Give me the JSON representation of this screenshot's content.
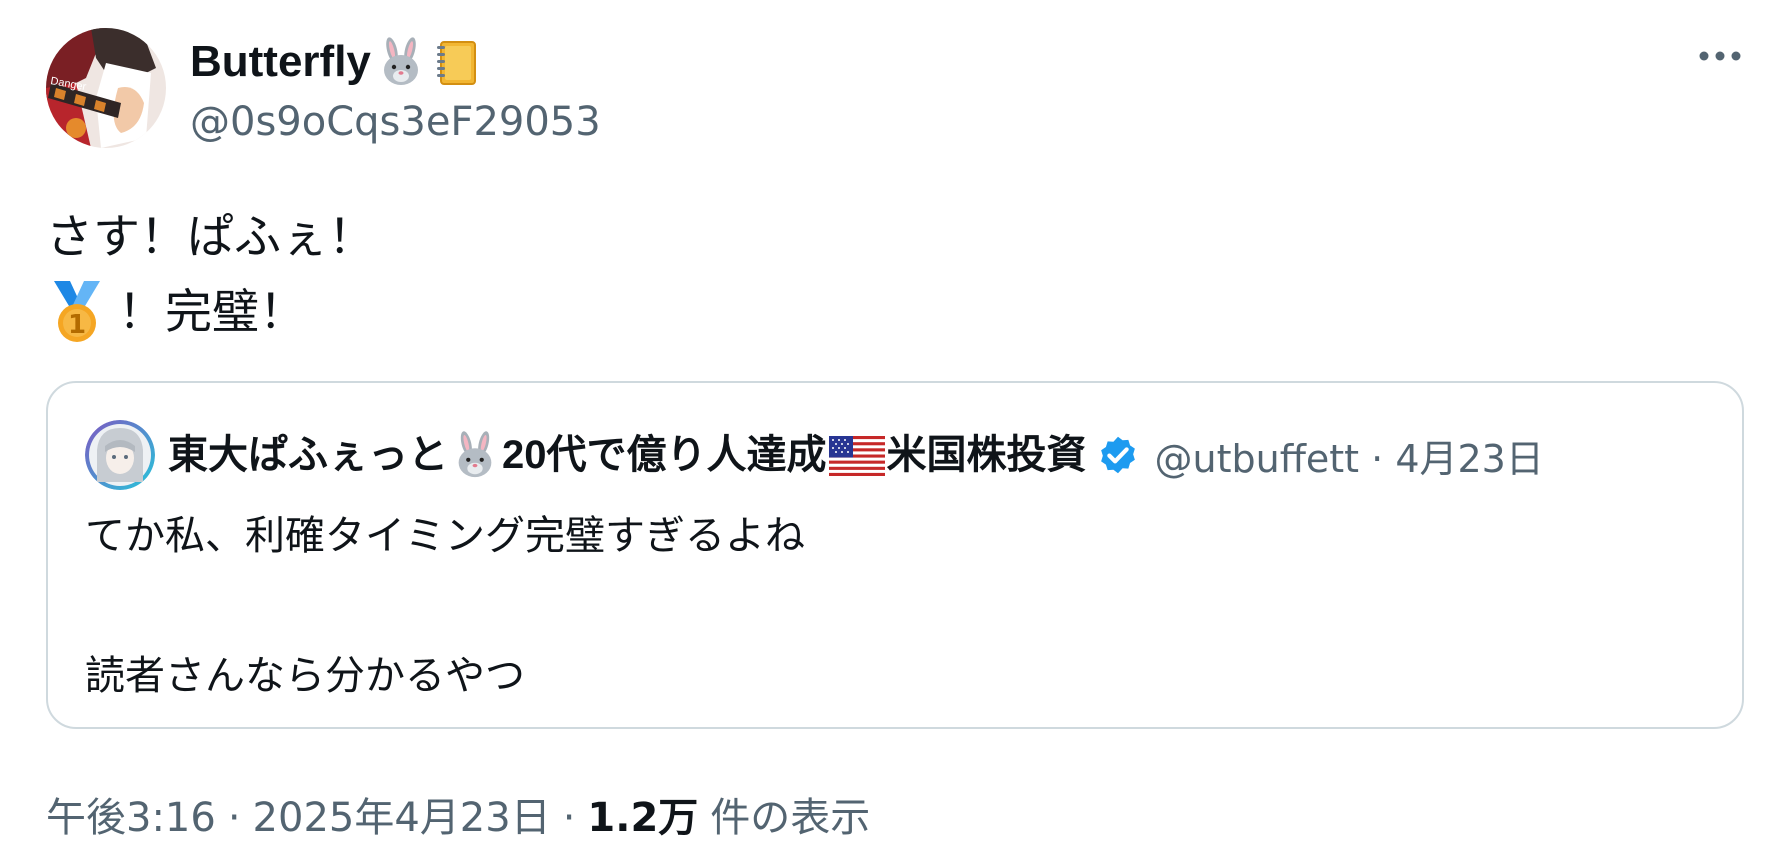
{
  "author": {
    "display_name": "Butterfly",
    "name_emojis": [
      "rabbit-icon",
      "notebook-icon"
    ],
    "handle": "@0s9oCqs3eF29053",
    "avatar_text": "Danger"
  },
  "menu": {
    "more_icon": "more-dots-icon"
  },
  "tweet": {
    "line1": "さす！ぱふぇ！",
    "line2_emoji": "first-place-medal-icon",
    "line2": "！完璧！"
  },
  "quote": {
    "name_part1": "東大ぱふぇっと",
    "name_part2": "20代で億り人達成",
    "name_part3": "米国株投資",
    "handle": "@utbuffett",
    "separator": "·",
    "date": "4月23日",
    "text": "てか私、利確タイミング完璧すぎるよね\n\n読者さんなら分かるやつ"
  },
  "footer": {
    "time": "午後3:16",
    "separator": "·",
    "date": "2025年4月23日",
    "views_count": "1.2万",
    "views_label": "件の表示"
  },
  "colors": {
    "text_primary": "#0f1419",
    "text_secondary": "#536471",
    "border": "#cfd9de",
    "verified_blue": "#1d9bf0"
  }
}
